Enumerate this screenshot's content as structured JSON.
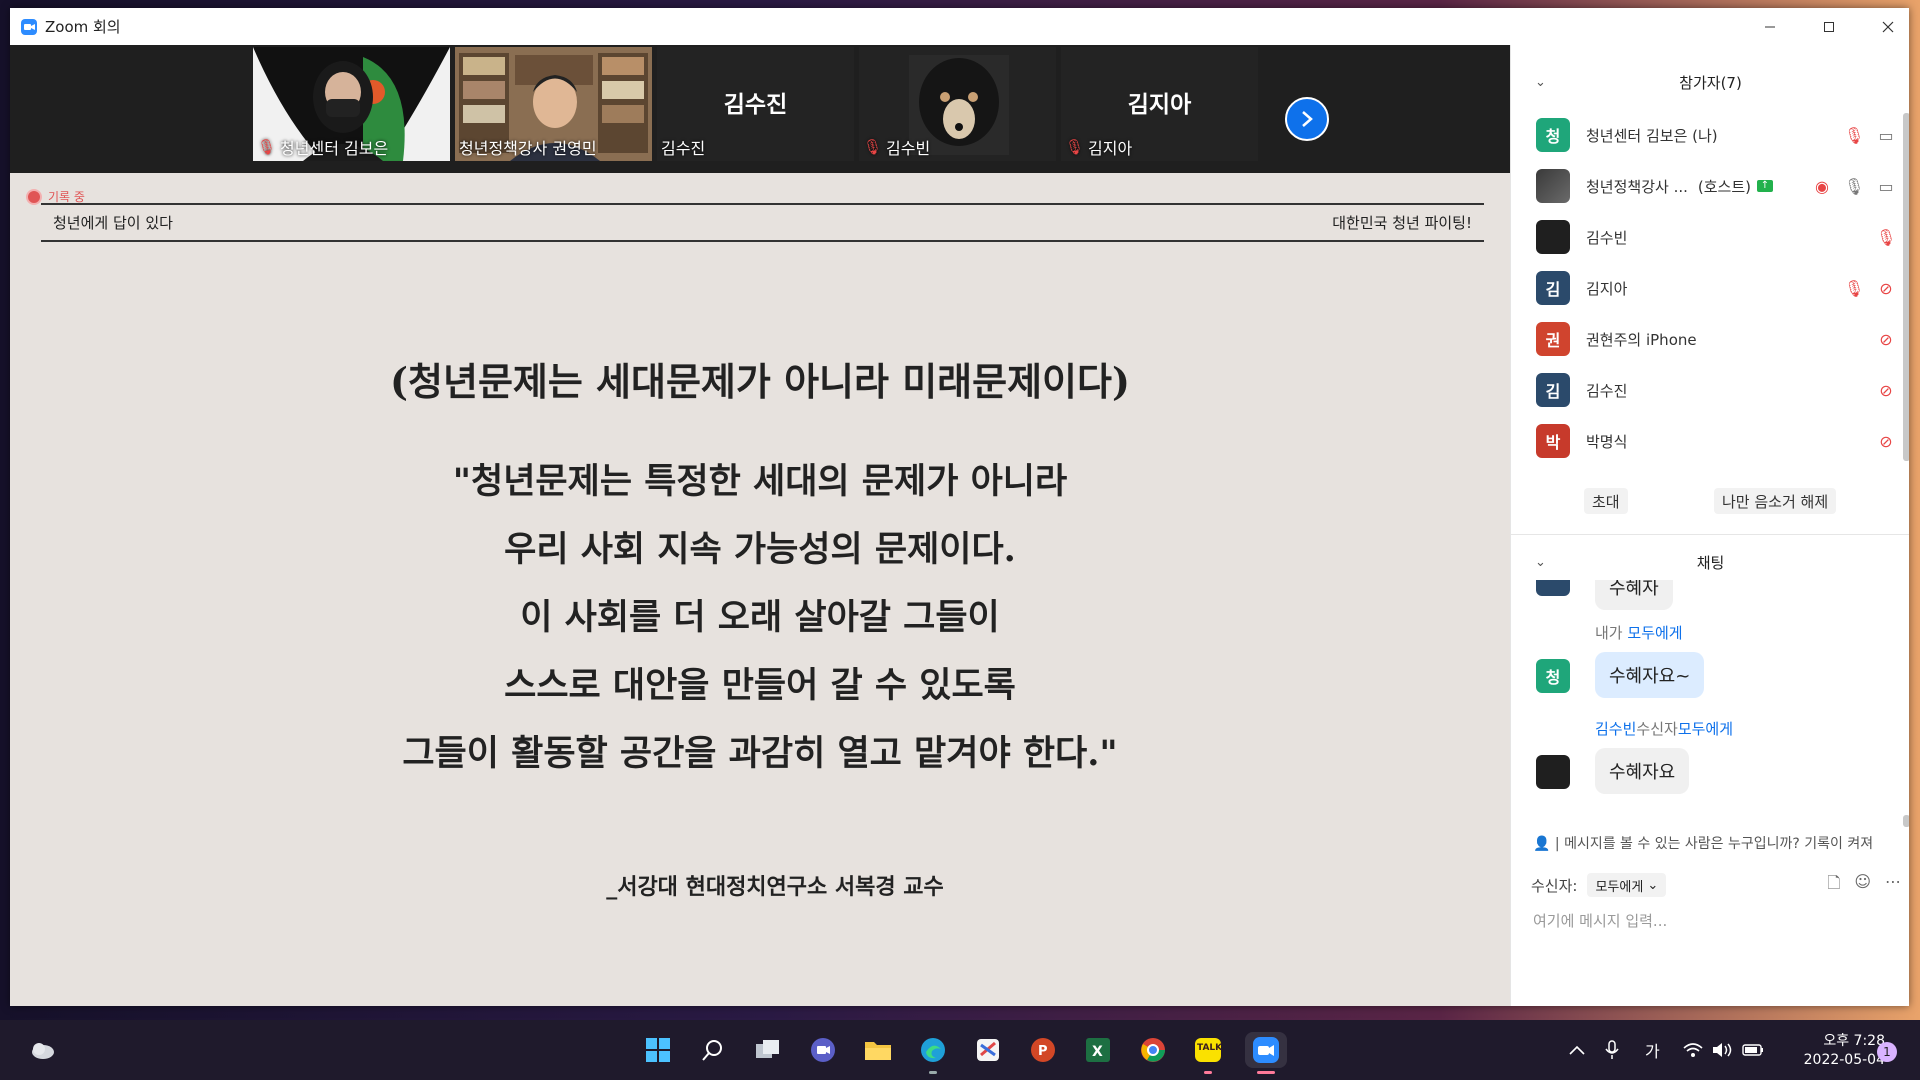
{
  "window": {
    "title": "Zoom 회의",
    "controls": {
      "minimize": "—",
      "maximize": "☐",
      "close": "✕"
    }
  },
  "video_strip": {
    "tiles": [
      {
        "name": "청년센터 김보은",
        "muted": true,
        "type": "video"
      },
      {
        "name": "청년정책강사 권영민",
        "muted": false,
        "type": "video",
        "active": true
      },
      {
        "name": "김수진",
        "big_name": "김수진",
        "muted": false,
        "type": "name-only"
      },
      {
        "name": "김수빈",
        "muted": true,
        "type": "video"
      },
      {
        "name": "김지아",
        "big_name": "김지아",
        "muted": true,
        "type": "name-only"
      }
    ],
    "next_icon": "chevron-right-icon"
  },
  "recording": {
    "label": "기록 중"
  },
  "slide": {
    "header_left": "청년에게 답이 있다",
    "header_right": "대한민국 청년 파이팅!",
    "heading": "(청년문제는 세대문제가 아니라 미래문제이다)",
    "quote": [
      "\"청년문제는 특정한 세대의 문제가 아니라",
      "우리 사회 지속 가능성의 문제이다.",
      "이 사회를 더 오래 살아갈 그들이",
      "스스로 대안을 만들어 갈 수 있도록",
      "그들이 활동할 공간을 과감히 열고 맡겨야 한다.\""
    ],
    "author": "_서강대 현대정치연구소 서복경 교수"
  },
  "participants_panel": {
    "title": "참가자(7)",
    "participants": [
      {
        "avatar": "청",
        "color": "#1fa67a",
        "name": "청년센터 김보은 (나)",
        "mic": "muted",
        "video": "on"
      },
      {
        "avatar": "",
        "color": "#555555",
        "name": "청년정책강사 ...",
        "role": "(호스트)",
        "mic": "on",
        "video": "on",
        "recording": true
      },
      {
        "avatar": "",
        "color": "#444444",
        "name": "김수빈",
        "mic": "muted",
        "video": "none"
      },
      {
        "avatar": "김",
        "color": "#2b4a6b",
        "name": "김지아",
        "mic": "muted",
        "video": "off"
      },
      {
        "avatar": "권",
        "color": "#d0442e",
        "name": "권현주의 iPhone",
        "mic": "none",
        "video": "off"
      },
      {
        "avatar": "김",
        "color": "#2b4a6b",
        "name": "김수진",
        "mic": "none",
        "video": "off"
      },
      {
        "avatar": "박",
        "color": "#c73a2b",
        "name": "박명식",
        "mic": "none",
        "video": "off"
      }
    ],
    "invite_label": "초대",
    "unmute_me_label": "나만 음소거 해제"
  },
  "chat_panel": {
    "title": "채팅",
    "partial_message": "수혜자",
    "messages": [
      {
        "from": "내가",
        "to": "모두에게",
        "avatar": "청",
        "text": "수혜자요~"
      },
      {
        "from": "김수빈",
        "mid": "수신자",
        "to": "모두에게",
        "avatar": "",
        "text": "수혜자요"
      }
    ],
    "privacy_note": "메시지를 볼 수 있는 사람은 누구입니까? 기록이 켜져",
    "recipient_label": "수신자:",
    "recipient_value": "모두에게",
    "input_placeholder": "여기에 메시지 입력..."
  },
  "taskbar": {
    "apps": [
      "windows-start-icon",
      "search-icon",
      "task-view-icon",
      "teams-icon",
      "file-explorer-icon",
      "edge-icon",
      "capture-icon",
      "powerpoint-icon",
      "excel-icon",
      "chrome-icon",
      "kakaotalk-icon",
      "zoom-icon"
    ],
    "kakao_label": "TALK",
    "ime_label": "가",
    "time": "오후 7:28",
    "date": "2022-05-04",
    "notification_count": "1"
  },
  "colors": {
    "zoom_blue": "#0e71eb",
    "slide_bg": "#e7e2de",
    "muted_red": "#e84545"
  }
}
